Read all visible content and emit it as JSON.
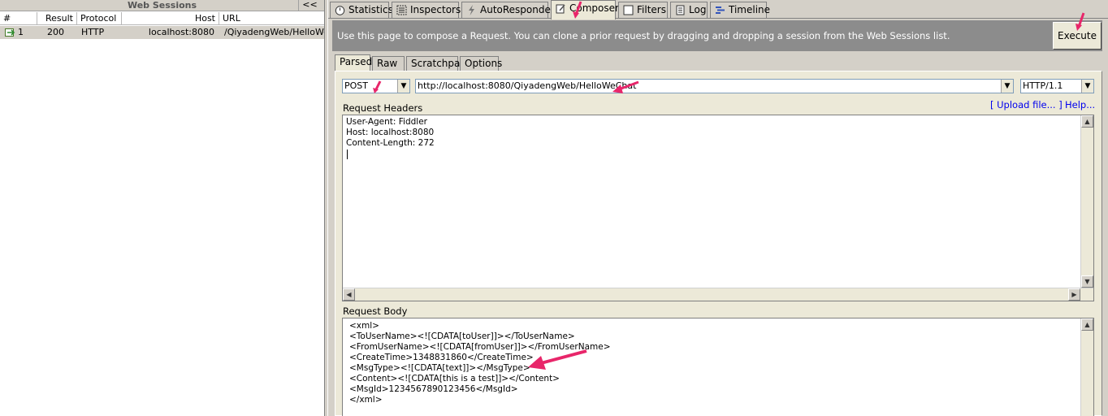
{
  "sessions": {
    "title": "Web Sessions",
    "collapse_label": "<<",
    "columns": [
      "#",
      "Result",
      "Protocol",
      "Host",
      "URL"
    ],
    "rows": [
      {
        "num": "1",
        "result": "200",
        "protocol": "HTTP",
        "host": "localhost:8080",
        "url": "/QiyadengWeb/HelloWeC"
      }
    ]
  },
  "tabs": [
    {
      "label": "Statistics",
      "icon": "stopwatch-icon"
    },
    {
      "label": "Inspectors",
      "icon": "inspector-icon"
    },
    {
      "label": "AutoResponder",
      "icon": "lightning-icon"
    },
    {
      "label": "Composer",
      "icon": "compose-icon"
    },
    {
      "label": "Filters",
      "icon": "checkbox-icon"
    },
    {
      "label": "Log",
      "icon": "log-icon"
    },
    {
      "label": "Timeline",
      "icon": "timeline-icon"
    }
  ],
  "active_tab": "Composer",
  "info_text": "Use this page to compose a Request. You can clone a prior request by dragging and dropping a session from the Web Sessions list.",
  "execute_label": "Execute",
  "subtabs": [
    "Parsed",
    "Raw",
    "Scratchpad",
    "Options"
  ],
  "active_subtab": "Parsed",
  "request": {
    "method": "POST",
    "url": "http://localhost:8080/QiyadengWeb/HelloWeChat",
    "version": "HTTP/1.1"
  },
  "headers_label": "Request Headers",
  "upload_label": "[ Upload file... ]",
  "help_label": "Help...",
  "headers_lines": [
    "User-Agent: Fiddler",
    "Host: localhost:8080",
    "Content-Length: 272"
  ],
  "body_label": "Request Body",
  "body_lines": [
    "<xml>",
    "<ToUserName><![CDATA[toUser]]></ToUserName>",
    "<FromUserName><![CDATA[fromUser]]></FromUserName>",
    "<CreateTime>1348831860</CreateTime>",
    "<MsgType><![CDATA[text]]></MsgType>",
    "<Content><![CDATA[this is a test]]></Content>",
    "<MsgId>1234567890123456</MsgId>",
    "</xml>"
  ],
  "colors": {
    "annotation": "#e8266a",
    "link": "#0000ee",
    "infobar": "#8c8c8c"
  }
}
